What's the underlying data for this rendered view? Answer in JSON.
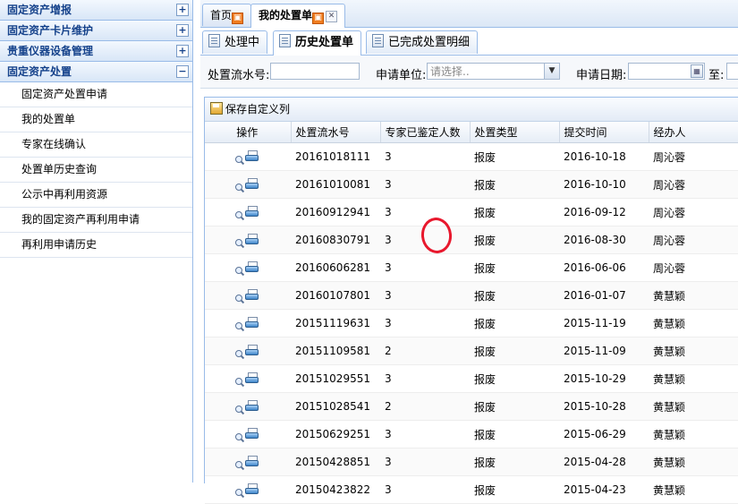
{
  "sidebar": {
    "sections": [
      {
        "title": "固定资产增报",
        "toggle": "+"
      },
      {
        "title": "固定资产卡片维护",
        "toggle": "+"
      },
      {
        "title": "贵重仪器设备管理",
        "toggle": "+"
      },
      {
        "title": "固定资产处置",
        "toggle": "−"
      }
    ],
    "items": [
      "固定资产处置申请",
      "我的处置单",
      "专家在线确认",
      "处置单历史查询",
      "公示中再利用资源",
      "我的固定资产再利用申请",
      "再利用申请历史"
    ]
  },
  "tabs": [
    {
      "label": "首页"
    },
    {
      "label": "我的处置单"
    }
  ],
  "subtabs": [
    {
      "label": "处理中"
    },
    {
      "label": "历史处置单"
    },
    {
      "label": "已完成处置明细"
    }
  ],
  "filters": {
    "serial_label": "处置流水号:",
    "serial_value": "",
    "unit_label": "申请单位:",
    "unit_placeholder": "请选择..",
    "date_label": "申请日期:",
    "date_value": "",
    "to_label": "至:"
  },
  "toolbar": {
    "save_columns_label": "保存自定义列"
  },
  "grid": {
    "columns": [
      "操作",
      "处置流水号",
      "专家已鉴定人数",
      "处置类型",
      "提交时间",
      "经办人"
    ],
    "rows": [
      [
        "20161018111",
        "3",
        "报废",
        "2016-10-18",
        "周沁蓉"
      ],
      [
        "20161010081",
        "3",
        "报废",
        "2016-10-10",
        "周沁蓉"
      ],
      [
        "20160912941",
        "3",
        "报废",
        "2016-09-12",
        "周沁蓉"
      ],
      [
        "20160830791",
        "3",
        "报废",
        "2016-08-30",
        "周沁蓉"
      ],
      [
        "20160606281",
        "3",
        "报废",
        "2016-06-06",
        "周沁蓉"
      ],
      [
        "20160107801",
        "3",
        "报废",
        "2016-01-07",
        "黄慧颖"
      ],
      [
        "20151119631",
        "3",
        "报废",
        "2015-11-19",
        "黄慧颖"
      ],
      [
        "20151109581",
        "2",
        "报废",
        "2015-11-09",
        "黄慧颖"
      ],
      [
        "20151029551",
        "3",
        "报废",
        "2015-10-29",
        "黄慧颖"
      ],
      [
        "20151028541",
        "2",
        "报废",
        "2015-10-28",
        "黄慧颖"
      ],
      [
        "20150629251",
        "3",
        "报废",
        "2015-06-29",
        "黄慧颖"
      ],
      [
        "20150428851",
        "3",
        "报废",
        "2015-04-28",
        "黄慧颖"
      ],
      [
        "20150423822",
        "3",
        "报废",
        "2015-04-23",
        "黄慧颖"
      ]
    ]
  },
  "colors": {
    "border_blue": "#99bbe8",
    "header_text": "#15428b",
    "annotation_red": "#e8182d"
  }
}
